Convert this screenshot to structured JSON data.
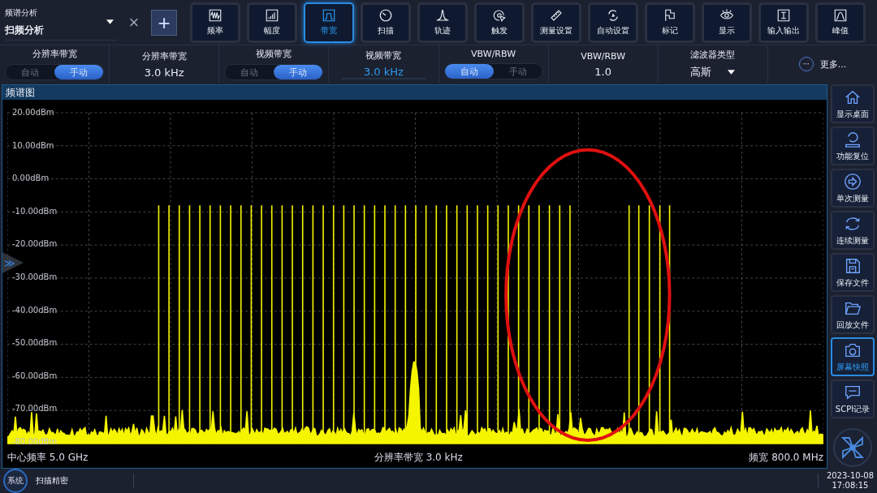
{
  "mode_selector": {
    "caption": "频谱分析",
    "value": "扫频分析",
    "close": "×",
    "add": "+"
  },
  "tools": [
    {
      "label": "频率",
      "selected": false
    },
    {
      "label": "幅度",
      "selected": false
    },
    {
      "label": "带宽",
      "selected": true
    },
    {
      "label": "扫描",
      "selected": false
    },
    {
      "label": "轨迹",
      "selected": false
    },
    {
      "label": "触发",
      "selected": false
    },
    {
      "label": "测量设置",
      "selected": false
    },
    {
      "label": "自动设置",
      "selected": false
    },
    {
      "label": "标记",
      "selected": false
    },
    {
      "label": "显示",
      "selected": false
    },
    {
      "label": "输入输出",
      "selected": false
    },
    {
      "label": "峰值",
      "selected": false
    }
  ],
  "settings": [
    {
      "kind": "toggle",
      "label": "分辨率带宽",
      "options": [
        {
          "label": "自动",
          "selected": false
        },
        {
          "label": "手动",
          "selected": true
        }
      ]
    },
    {
      "kind": "value",
      "label": "分辨率带宽",
      "value": "3.0 kHz",
      "active": false
    },
    {
      "kind": "toggle",
      "label": "视频带宽",
      "options": [
        {
          "label": "自动",
          "selected": false
        },
        {
          "label": "手动",
          "selected": true
        }
      ]
    },
    {
      "kind": "value",
      "label": "视频带宽",
      "value": "3.0 kHz",
      "active": true
    },
    {
      "kind": "toggle",
      "label": "VBW/RBW",
      "options": [
        {
          "label": "自动",
          "selected": true
        },
        {
          "label": "手动",
          "selected": false
        }
      ]
    },
    {
      "kind": "value",
      "label": "VBW/RBW",
      "value": "1.0",
      "active": false
    },
    {
      "kind": "dropdown",
      "label": "滤波器类型",
      "value": "高斯"
    },
    {
      "kind": "more",
      "label": "更多...",
      "icon": "···"
    }
  ],
  "chart": {
    "title": "频谱图",
    "handle": "≫",
    "yticks": [
      "20.00dBm",
      "10.00dBm",
      "0.00dBm",
      "-10.00dBm",
      "-20.00dBm",
      "-30.00dBm",
      "-40.00dBm",
      "-50.00dBm",
      "-60.00dBm",
      "-70.00dBm",
      "-80.00dBm"
    ],
    "footer": [
      "中心频率 5.0 GHz",
      "分辨率带宽 3.0 kHz",
      "频宽 800.0 MHz"
    ]
  },
  "sidebar": [
    {
      "label": "显示桌面",
      "selected": false
    },
    {
      "label": "功能复位",
      "selected": false
    },
    {
      "label": "单次测量",
      "selected": false
    },
    {
      "label": "连续测量",
      "selected": false
    },
    {
      "label": "保存文件",
      "selected": false
    },
    {
      "label": "回放文件",
      "selected": false
    },
    {
      "label": "屏幕快照",
      "selected": true
    },
    {
      "label": "SCPI记录",
      "selected": false
    }
  ],
  "status_bar": {
    "system": "系统",
    "status": "扫描精密",
    "date": "2023-10-08",
    "time": "17:08:15"
  }
}
